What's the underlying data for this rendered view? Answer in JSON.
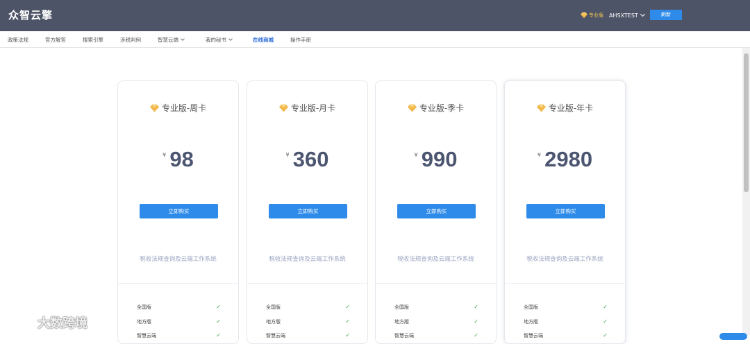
{
  "header": {
    "logo": "众智云擎",
    "edition_badge": "专业版",
    "username": "AHSXTEST",
    "refresh_label": "刷新"
  },
  "nav": {
    "items": [
      {
        "label": "政策法规"
      },
      {
        "label": "官方解答"
      },
      {
        "label": "搜索引擎"
      },
      {
        "label": "涉税判例"
      },
      {
        "label": "智慧云端"
      },
      {
        "label": "我的秘书"
      },
      {
        "label": "在线商城"
      },
      {
        "label": "操作手册"
      }
    ],
    "active": "在线商城"
  },
  "plans": [
    {
      "title": "专业版-周卡",
      "currency": "¥",
      "price": "98",
      "buy_label": "立即购买",
      "description": "税收法规查询及云端工作系统",
      "features": [
        {
          "label": "全国版",
          "check": "✓"
        },
        {
          "label": "地方版",
          "check": "✓"
        },
        {
          "label": "智慧云端",
          "check": "✓"
        }
      ]
    },
    {
      "title": "专业版-月卡",
      "currency": "¥",
      "price": "360",
      "buy_label": "立即购买",
      "description": "税收法规查询及云端工作系统",
      "features": [
        {
          "label": "全国版",
          "check": "✓"
        },
        {
          "label": "地方版",
          "check": "✓"
        },
        {
          "label": "智慧云端",
          "check": "✓"
        }
      ]
    },
    {
      "title": "专业版-季卡",
      "currency": "¥",
      "price": "990",
      "buy_label": "立即购买",
      "description": "税收法规查询及云端工作系统",
      "features": [
        {
          "label": "全国版",
          "check": "✓"
        },
        {
          "label": "地方版",
          "check": "✓"
        },
        {
          "label": "智慧云端",
          "check": "✓"
        }
      ]
    },
    {
      "title": "专业版-年卡",
      "currency": "¥",
      "price": "2980",
      "buy_label": "立即购买",
      "description": "税收法规查询及云端工作系统",
      "features": [
        {
          "label": "全国版",
          "check": "✓"
        },
        {
          "label": "地方版",
          "check": "✓"
        },
        {
          "label": "智慧云端",
          "check": "✓"
        }
      ]
    }
  ],
  "watermark": "大数跨境",
  "colors": {
    "header_bg": "#4e5467",
    "primary": "#2f8bea",
    "price": "#4c5670",
    "gem": "#f2b84b",
    "check": "#3aa34a"
  },
  "icons": {
    "edition": "diamond-icon",
    "check": "check-icon",
    "dropdown": "chevron-down-icon"
  }
}
